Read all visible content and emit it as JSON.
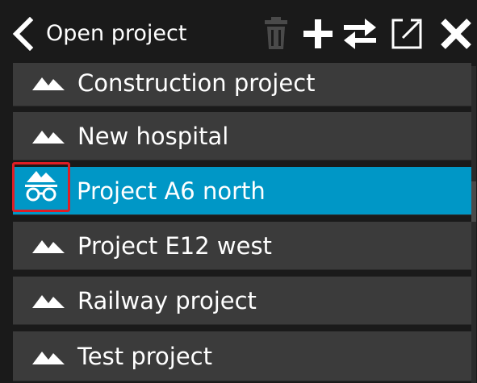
{
  "header": {
    "title": "Open project",
    "back_icon": "chevron-left-icon",
    "tools": [
      {
        "name": "delete",
        "icon": "trash-icon",
        "enabled": false
      },
      {
        "name": "add",
        "icon": "plus-icon",
        "enabled": true
      },
      {
        "name": "transfer",
        "icon": "swap-arrows-icon",
        "enabled": true
      },
      {
        "name": "open-external",
        "icon": "external-link-icon",
        "enabled": true
      },
      {
        "name": "close",
        "icon": "close-icon",
        "enabled": true
      }
    ]
  },
  "projects": [
    {
      "label": "Construction project",
      "icon": "mountain-icon",
      "selected": false
    },
    {
      "label": "New hospital",
      "icon": "mountain-icon",
      "selected": false
    },
    {
      "label": "Project A6 north",
      "icon": "mountain-glasses-icon",
      "selected": true
    },
    {
      "label": "Project E12 west",
      "icon": "mountain-icon",
      "selected": false
    },
    {
      "label": "Railway project",
      "icon": "mountain-icon",
      "selected": false
    },
    {
      "label": "Test project",
      "icon": "mountain-icon",
      "selected": false
    }
  ],
  "colors": {
    "background": "#1a1a1a",
    "row": "#3b3b3b",
    "selected_row": "#0097c6",
    "highlight_outline": "#e01e25",
    "disabled_icon": "#4a4a4a"
  }
}
